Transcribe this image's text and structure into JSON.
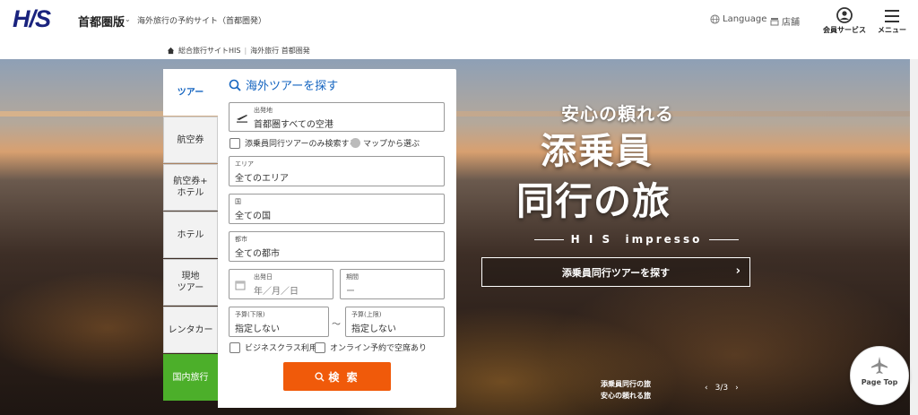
{
  "header": {
    "logo": "H/S",
    "region": "首都圏版",
    "tagline": "海外旅行の予約サイト（首都圏発）",
    "language_label": "Language",
    "stores_label": "店舗",
    "member_label": "会員サービス",
    "menu_label": "メニュー"
  },
  "breadcrumb": {
    "items": [
      "総合旅行サイトHIS",
      "海外旅行 首都圏発"
    ]
  },
  "tabs": [
    {
      "label": "ツアー"
    },
    {
      "label": "航空券"
    },
    {
      "label": "航空券+\nホテル"
    },
    {
      "label": "ホテル"
    },
    {
      "label": "現地\nツアー"
    },
    {
      "label": "レンタカー"
    },
    {
      "label": "国内旅行"
    }
  ],
  "search": {
    "title": "海外ツアーを探す",
    "departure_label": "出発地",
    "departure_value": "首都圏すべての空港",
    "escort_only_label": "添乗員同行ツアーのみ検索する",
    "map_select_label": "マップから選ぶ",
    "area_label": "エリア",
    "area_value": "全てのエリア",
    "country_label": "国",
    "country_value": "全ての国",
    "city_label": "都市",
    "city_value": "全ての都市",
    "date_label": "出発日",
    "date_value": "年／月／日",
    "duration_label": "期間",
    "duration_value": "ー",
    "budget_min_label": "予算(下限)",
    "budget_min_value": "指定しない",
    "budget_max_label": "予算(上限)",
    "budget_max_value": "指定しない",
    "tilde": "～",
    "business_class_label": "ビジネスクラス利用",
    "online_booking_label": "オンライン予約で空席あり",
    "search_button": "検 索"
  },
  "hero": {
    "subtitle": "安心の頼れる",
    "title_line1": "添乗員",
    "title_line2": "同行の旅",
    "brand": "H I S  impresso",
    "cta": "添乗員同行ツアーを探す",
    "caption_line1": "添乗員同行の旅",
    "caption_line2": "安心の頼れる旅",
    "pager": "3/3"
  },
  "page_top": {
    "label": "Page Top"
  },
  "colors": {
    "brand_navy": "#1a237e",
    "accent_blue": "#1565c0",
    "search_orange": "#f05a0a",
    "domestic_green": "#4caf2a"
  }
}
